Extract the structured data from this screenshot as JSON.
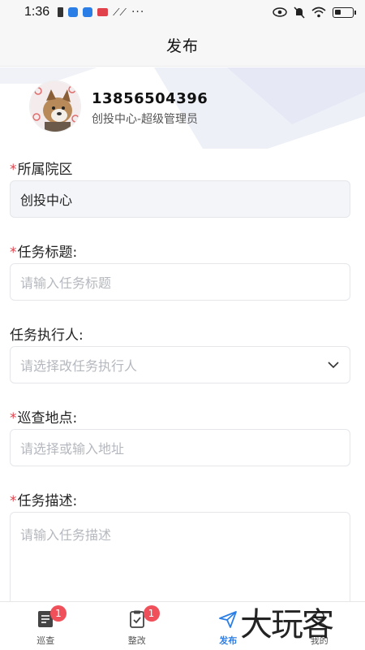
{
  "status_bar": {
    "time": "1:36",
    "more_indicator": "···",
    "icons_left": [
      "sim-icon",
      "cloud-icon",
      "cloud-icon",
      "app-icon",
      "signal-icon"
    ],
    "icons_right": [
      "eye-icon",
      "mute-icon",
      "wifi-icon",
      "battery-icon"
    ]
  },
  "header": {
    "title": "发布"
  },
  "profile": {
    "phone": "13856504396",
    "role": "创投中心-超级管理员"
  },
  "form": {
    "campus": {
      "required": "*",
      "label": "所属院区",
      "value": "创投中心"
    },
    "task_title": {
      "required": "*",
      "label": "任务标题:",
      "placeholder": "请输入任务标题"
    },
    "executor": {
      "label": "任务执行人:",
      "placeholder": "请选择改任务执行人"
    },
    "location": {
      "required": "*",
      "label": "巡查地点:",
      "placeholder": "请选择或输入地址"
    },
    "description": {
      "required": "*",
      "label": "任务描述:",
      "placeholder": "请输入任务描述"
    }
  },
  "bottom_nav": {
    "items": [
      {
        "label": "巡查",
        "badge": "1",
        "icon": "list-icon"
      },
      {
        "label": "整改",
        "badge": "1",
        "icon": "clipboard-icon"
      },
      {
        "label": "发布",
        "icon": "send-icon",
        "active": true
      },
      {
        "label": "我的",
        "icon": "user-icon"
      }
    ]
  },
  "watermark": "大玩客",
  "colors": {
    "accent": "#2a7ee6",
    "required": "#e0414b",
    "badge": "#f0505a"
  }
}
